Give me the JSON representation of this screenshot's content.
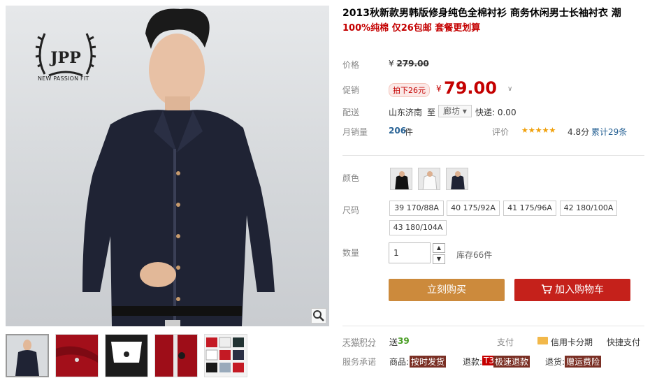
{
  "gallery": {
    "brand_name": "JPP",
    "brand_tagline": "NEW PASSION FIT",
    "zoom_icon": "magnifier-icon",
    "thumbnails": [
      {
        "name": "model-front-thumb"
      },
      {
        "name": "red-fabric-detail-thumb"
      },
      {
        "name": "collar-label-thumb"
      },
      {
        "name": "button-detail-thumb"
      },
      {
        "name": "color-options-thumb"
      }
    ]
  },
  "product": {
    "title": "2013秋新款男韩版修身纯色全棉衬衫 商务休闲男士长袖衬衣 潮",
    "subtitle": "100%纯棉 仅26包邮 套餐更划算"
  },
  "price": {
    "label": "价格",
    "original_symbol": "¥",
    "original_value": "279.00",
    "promo_label": "促销",
    "promo_badge": "拍下26元",
    "promo_symbol": "¥",
    "promo_value": "79.00"
  },
  "shipping": {
    "label": "配送",
    "origin": "山东济南",
    "to_label": "至",
    "destination": "廊坊",
    "express": "快递: 0.00"
  },
  "sales": {
    "label": "月销量",
    "count": "206",
    "unit": "件",
    "rating_label": "评价",
    "stars": "★★★★★",
    "score": "4.8分",
    "review_total": "累计29条"
  },
  "color": {
    "label": "颜色",
    "options": [
      "black-shirt",
      "white-shirt",
      "navy-shirt"
    ]
  },
  "size": {
    "label": "尺码",
    "options": [
      "39 170/88A",
      "40 175/92A",
      "41 175/96A",
      "42 180/100A",
      "43 180/104A"
    ]
  },
  "quantity": {
    "label": "数量",
    "value": "1",
    "stock": "库存66件"
  },
  "actions": {
    "buy_now": "立刻购买",
    "add_to_cart": "加入购物车"
  },
  "footer": {
    "points_label": "天猫积分",
    "points_prefix": "送",
    "points_value": "39",
    "pay_label": "支付",
    "credit_installment": "信用卡分期",
    "quick_pay": "快捷支付",
    "service_label": "服务承诺",
    "goods_label": "商品:",
    "goods_tag": "按时发货",
    "refund_label": "退款:",
    "refund_t3": "T3",
    "refund_tag": "极速退款",
    "return_label": "退货:",
    "return_tag": "赠运费险"
  },
  "colors": {
    "accent_red": "#c40000",
    "buy_orange": "#cc8a3c",
    "cart_red": "#c5211b",
    "shirt_navy": "#1f2334"
  }
}
